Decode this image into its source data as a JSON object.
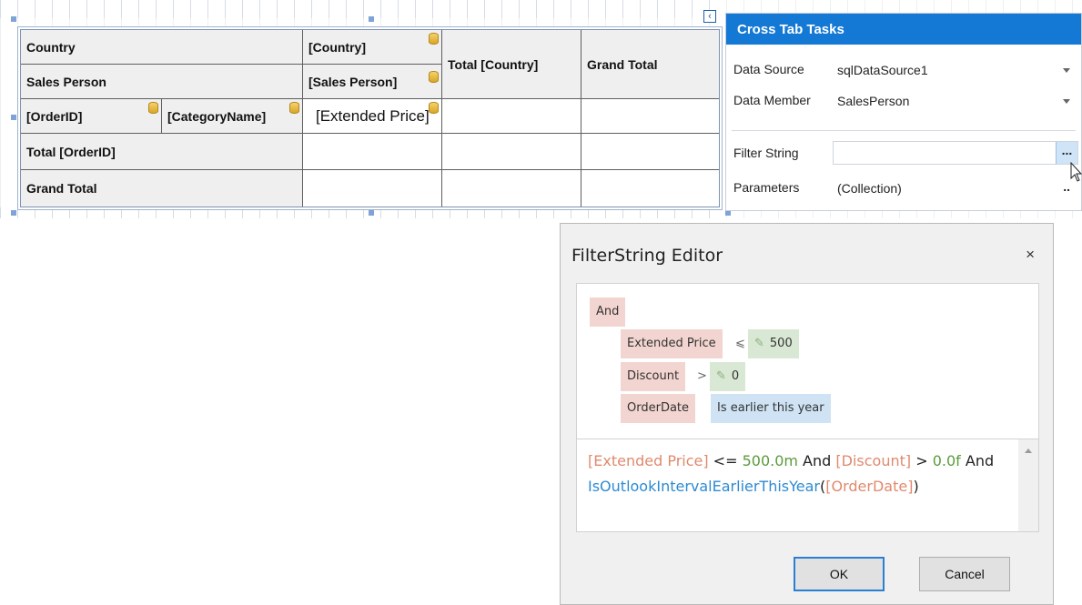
{
  "crosstab": {
    "header_row1": {
      "c0": "Country",
      "c1": "[Country]",
      "c2": "Total [Country]",
      "c3": "Grand Total"
    },
    "header_row2": {
      "c0": "Sales Person",
      "c1": "[Sales Person]"
    },
    "data_row": {
      "c0": "[OrderID]",
      "c1": "[CategoryName]",
      "c2": "[Extended Price]"
    },
    "total_row": {
      "c0": "Total [OrderID]"
    },
    "grand_row": {
      "c0": "Grand Total"
    }
  },
  "tasks": {
    "title": "Cross Tab Tasks",
    "data_source_label": "Data Source",
    "data_source_value": "sqlDataSource1",
    "data_member_label": "Data Member",
    "data_member_value": "SalesPerson",
    "filter_label": "Filter String",
    "filter_value": "",
    "filter_button": "...",
    "parameters_label": "Parameters",
    "parameters_value": "(Collection)",
    "parameters_button": "..",
    "collapse_icon": "chevron-left-icon"
  },
  "dialog": {
    "title": "FilterString Editor",
    "close": "×",
    "tree": {
      "group": "And",
      "conditions": [
        {
          "field": "Extended Price",
          "op": "⩽",
          "value": "500"
        },
        {
          "field": "Discount",
          "op": ">",
          "value": "0"
        },
        {
          "field": "OrderDate",
          "op": "Is earlier this year"
        }
      ]
    },
    "expression": {
      "p1": "[Extended Price]",
      "p2": " <= ",
      "p3": "500.0m",
      "p4": " And ",
      "p5": "[Discount]",
      "p6": " > ",
      "p7": "0.0f",
      "p8": " And",
      "p9": "IsOutlookIntervalEarlierThisYear",
      "p10": "(",
      "p11": "[OrderDate]",
      "p12": ")"
    },
    "ok": "OK",
    "cancel": "Cancel"
  }
}
